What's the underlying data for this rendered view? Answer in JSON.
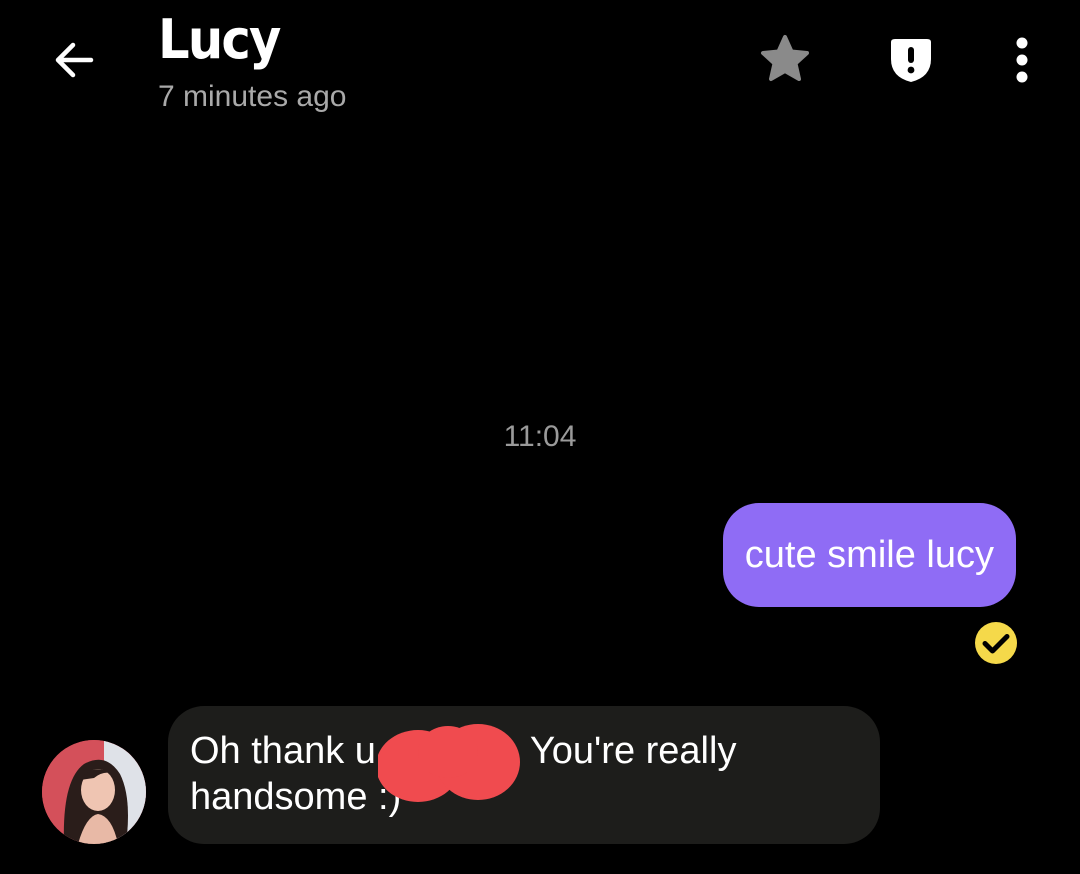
{
  "header": {
    "title": "Lucy",
    "status": "7 minutes ago",
    "icons": [
      "back-arrow-icon",
      "star-icon",
      "shield-alert-icon",
      "more-vertical-icon"
    ]
  },
  "conversation": {
    "time_separator": "11:04",
    "messages": [
      {
        "direction": "outgoing",
        "text": "cute smile lucy",
        "status_icon": "read-check-icon"
      },
      {
        "direction": "incoming",
        "line1_before": "Oh thank u",
        "line1_after": "You're really",
        "line2": "handsome :)",
        "redaction_color": "#f04b4f"
      }
    ]
  },
  "colors": {
    "background": "#000000",
    "outgoing_bubble": "#8f6cf5",
    "incoming_bubble": "#1d1d1b",
    "read_check": "#f5d94a",
    "muted_text": "#a9a9a9"
  }
}
